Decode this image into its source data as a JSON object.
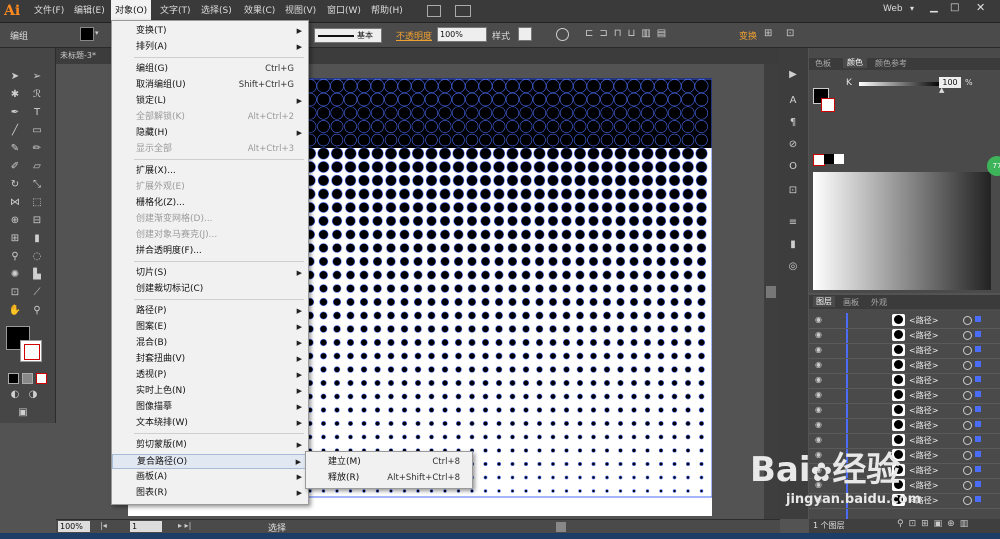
{
  "app": {
    "logo": "Ai",
    "workspace": "Web"
  },
  "menubar": {
    "items": [
      "文件(F)",
      "编辑(E)",
      "对象(O)",
      "文字(T)",
      "选择(S)",
      "效果(C)",
      "视图(V)",
      "窗口(W)",
      "帮助(H)"
    ]
  },
  "control": {
    "selection_label": "编组",
    "stroke_style": "基本",
    "opacity_label": "不透明度",
    "opacity_value": "100%",
    "style_label": "样式",
    "transform_label": "变换"
  },
  "doc_tab": {
    "title": "未标题-3*"
  },
  "object_menu": {
    "items": [
      {
        "label": "变换(T)",
        "shortcut": "",
        "submenu": true,
        "disabled": false
      },
      {
        "label": "排列(A)",
        "shortcut": "",
        "submenu": true,
        "disabled": false
      },
      {
        "label": "编组(G)",
        "shortcut": "Ctrl+G",
        "submenu": false,
        "disabled": false
      },
      {
        "label": "取消编组(U)",
        "shortcut": "Shift+Ctrl+G",
        "submenu": false,
        "disabled": false
      },
      {
        "label": "锁定(L)",
        "shortcut": "",
        "submenu": true,
        "disabled": false
      },
      {
        "label": "全部解锁(K)",
        "shortcut": "Alt+Ctrl+2",
        "submenu": false,
        "disabled": true
      },
      {
        "label": "隐藏(H)",
        "shortcut": "",
        "submenu": true,
        "disabled": false
      },
      {
        "label": "显示全部",
        "shortcut": "Alt+Ctrl+3",
        "submenu": false,
        "disabled": true
      },
      {
        "label": "扩展(X)...",
        "shortcut": "",
        "submenu": false,
        "disabled": false
      },
      {
        "label": "扩展外观(E)",
        "shortcut": "",
        "submenu": false,
        "disabled": true
      },
      {
        "label": "栅格化(Z)...",
        "shortcut": "",
        "submenu": false,
        "disabled": false
      },
      {
        "label": "创建渐变网格(D)...",
        "shortcut": "",
        "submenu": false,
        "disabled": true
      },
      {
        "label": "创建对象马赛克(J)...",
        "shortcut": "",
        "submenu": false,
        "disabled": true
      },
      {
        "label": "拼合透明度(F)...",
        "shortcut": "",
        "submenu": false,
        "disabled": false
      },
      {
        "label": "切片(S)",
        "shortcut": "",
        "submenu": true,
        "disabled": false
      },
      {
        "label": "创建裁切标记(C)",
        "shortcut": "",
        "submenu": false,
        "disabled": false
      },
      {
        "label": "路径(P)",
        "shortcut": "",
        "submenu": true,
        "disabled": false
      },
      {
        "label": "图案(E)",
        "shortcut": "",
        "submenu": true,
        "disabled": false
      },
      {
        "label": "混合(B)",
        "shortcut": "",
        "submenu": true,
        "disabled": false
      },
      {
        "label": "封套扭曲(V)",
        "shortcut": "",
        "submenu": true,
        "disabled": false
      },
      {
        "label": "透视(P)",
        "shortcut": "",
        "submenu": true,
        "disabled": false
      },
      {
        "label": "实时上色(N)",
        "shortcut": "",
        "submenu": true,
        "disabled": false
      },
      {
        "label": "图像描摹",
        "shortcut": "",
        "submenu": true,
        "disabled": false
      },
      {
        "label": "文本绕排(W)",
        "shortcut": "",
        "submenu": true,
        "disabled": false
      },
      {
        "label": "剪切蒙版(M)",
        "shortcut": "",
        "submenu": true,
        "disabled": false
      },
      {
        "label": "复合路径(O)",
        "shortcut": "",
        "submenu": true,
        "disabled": false
      },
      {
        "label": "画板(A)",
        "shortcut": "",
        "submenu": true,
        "disabled": false
      },
      {
        "label": "图表(R)",
        "shortcut": "",
        "submenu": true,
        "disabled": false
      }
    ]
  },
  "compound_submenu": {
    "items": [
      {
        "label": "建立(M)",
        "shortcut": "Ctrl+8"
      },
      {
        "label": "释放(R)",
        "shortcut": "Alt+Shift+Ctrl+8"
      }
    ]
  },
  "color_panel": {
    "tabs": [
      "色板",
      "颜色",
      "颜色参考"
    ],
    "channel": "K",
    "value": "100",
    "unit": "%"
  },
  "layers_panel": {
    "tabs": [
      "图层",
      "画板",
      "外观"
    ],
    "row_label": "<路径>",
    "footer": "1 个图层"
  },
  "status": {
    "zoom": "100%",
    "artboard": "1",
    "tool": "选择"
  },
  "badge": {
    "text": "77"
  },
  "watermark": {
    "brand": "Bai",
    "brand2": "经验",
    "url": "jingyan.baidu.com"
  },
  "colors": {
    "accent_orange": "#ff8a1e",
    "selection_blue": "#4a6cf7",
    "menu_bg": "#f1f1f1",
    "highlight": "#e2e8f1"
  }
}
